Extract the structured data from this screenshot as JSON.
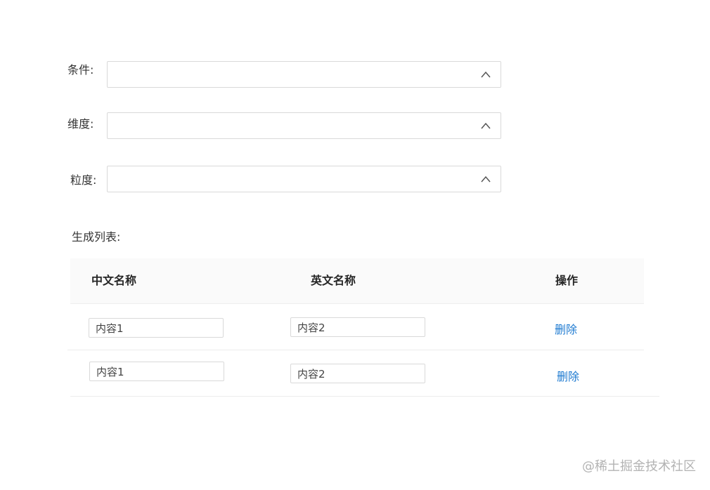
{
  "form": {
    "fields": [
      {
        "label": "条件:",
        "value": ""
      },
      {
        "label": "维度:",
        "value": ""
      },
      {
        "label": "粒度:",
        "value": ""
      }
    ]
  },
  "list": {
    "section_label": "生成列表:",
    "columns": [
      "中文名称",
      "英文名称",
      "操作"
    ],
    "rows": [
      {
        "cn_name": "内容1",
        "en_name": "内容2",
        "action": "删除"
      },
      {
        "cn_name": "内容1",
        "en_name": "内容2",
        "action": "删除"
      }
    ]
  },
  "watermark": "@稀土掘金技术社区",
  "colors": {
    "link": "#1f7bd1",
    "border": "#d9d9d9",
    "header_bg": "#fafafa"
  },
  "icons": {
    "select_arrow": "chevron-up-icon"
  }
}
